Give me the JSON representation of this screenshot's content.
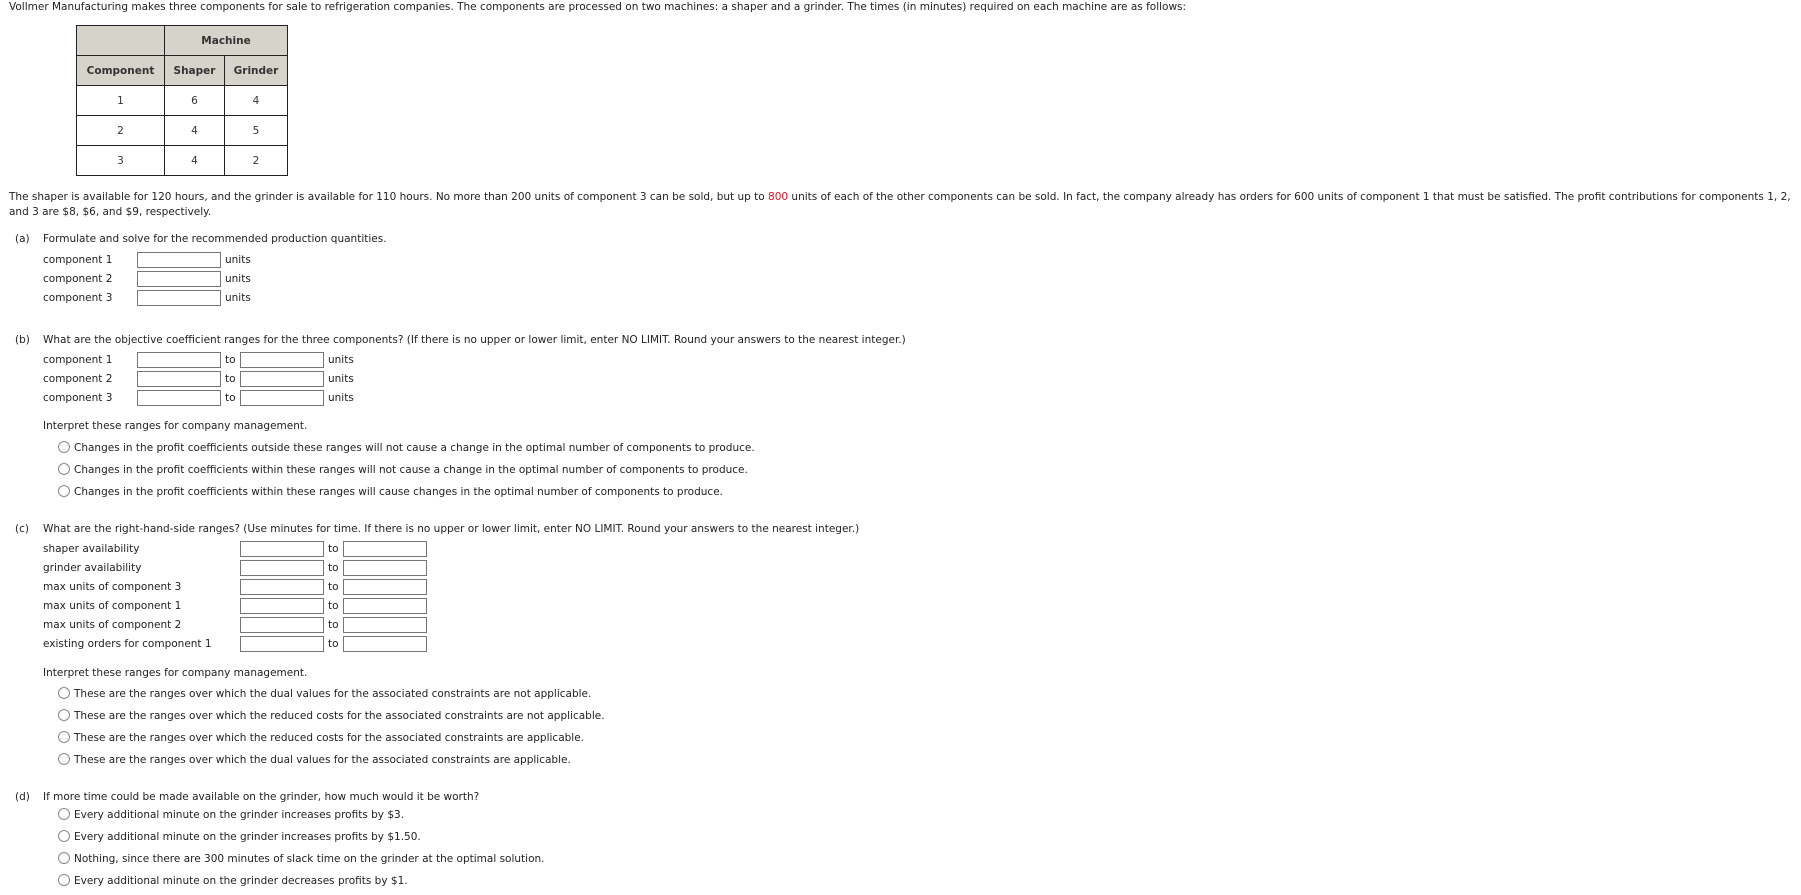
{
  "intro": "Vollmer Manufacturing makes three components for sale to refrigeration companies. The components are processed on two machines: a shaper and a grinder. The times (in minutes) required on each machine are as follows:",
  "table": {
    "group_header": "Machine",
    "headers": [
      "Component",
      "Shaper",
      "Grinder"
    ],
    "rows": [
      [
        "1",
        "6",
        "4"
      ],
      [
        "2",
        "4",
        "5"
      ],
      [
        "3",
        "4",
        "2"
      ]
    ]
  },
  "paragraph": {
    "part1": "The shaper is available for 120 hours, and the grinder is available for 110 hours. No more than 200 units of component 3 can be sold, but up to ",
    "highlight": "800",
    "part2": " units of each of the other components can be sold. In fact, the company already has orders for 600 units of component 1 that must be satisfied. The profit contributions for components 1, 2, and 3 are $8, $6, and $9, respectively.",
    "highlight_color": "#e8101e"
  },
  "part_a": {
    "letter": "(a)",
    "question": "Formulate and solve for the recommended production quantities.",
    "rows": [
      {
        "label": "component 1",
        "value": "",
        "unit": "units"
      },
      {
        "label": "component 2",
        "value": "",
        "unit": "units"
      },
      {
        "label": "component 3",
        "value": "",
        "unit": "units"
      }
    ]
  },
  "part_b": {
    "letter": "(b)",
    "question": "What are the objective coefficient ranges for the three components? (If there is no upper or lower limit, enter NO LIMIT. Round your answers to the nearest integer.)",
    "rows": [
      {
        "label": "component 1",
        "from": "",
        "to_label": "to",
        "to": "",
        "unit": "units"
      },
      {
        "label": "component 2",
        "from": "",
        "to_label": "to",
        "to": "",
        "unit": "units"
      },
      {
        "label": "component 3",
        "from": "",
        "to_label": "to",
        "to": "",
        "unit": "units"
      }
    ],
    "interpret_prompt": "Interpret these ranges for company management.",
    "options": [
      "Changes in the profit coefficients outside these ranges will not cause a change in the optimal number of components to produce.",
      "Changes in the profit coefficients within these ranges will not cause a change in the optimal number of components to produce.",
      "Changes in the profit coefficients within these ranges will cause changes in the optimal number of components to produce."
    ]
  },
  "part_c": {
    "letter": "(c)",
    "question": "What are the right-hand-side ranges? (Use minutes for time. If there is no upper or lower limit, enter NO LIMIT. Round your answers to the nearest integer.)",
    "rows": [
      {
        "label": "shaper availability",
        "from": "",
        "to_label": "to",
        "to": ""
      },
      {
        "label": "grinder availability",
        "from": "",
        "to_label": "to",
        "to": ""
      },
      {
        "label": "max units of component 3",
        "from": "",
        "to_label": "to",
        "to": ""
      },
      {
        "label": "max units of component 1",
        "from": "",
        "to_label": "to",
        "to": ""
      },
      {
        "label": "max units of component 2",
        "from": "",
        "to_label": "to",
        "to": ""
      },
      {
        "label": "existing orders for component 1",
        "from": "",
        "to_label": "to",
        "to": ""
      }
    ],
    "interpret_prompt": "Interpret these ranges for company management.",
    "options": [
      "These are the ranges over which the dual values for the associated constraints are not applicable.",
      "These are the ranges over which the reduced costs for the associated constraints are not applicable.",
      "These are the ranges over which the reduced costs for the associated constraints are applicable.",
      "These are the ranges over which the dual values for the associated constraints are applicable."
    ]
  },
  "part_d": {
    "letter": "(d)",
    "question": "If more time could be made available on the grinder, how much would it be worth?",
    "options": [
      "Every additional minute on the grinder increases profits by $3.",
      "Every additional minute on the grinder increases profits by $1.50.",
      "Nothing, since there are 300 minutes of slack time on the grinder at the optimal solution.",
      "Every additional minute on the grinder decreases profits by $1."
    ]
  }
}
